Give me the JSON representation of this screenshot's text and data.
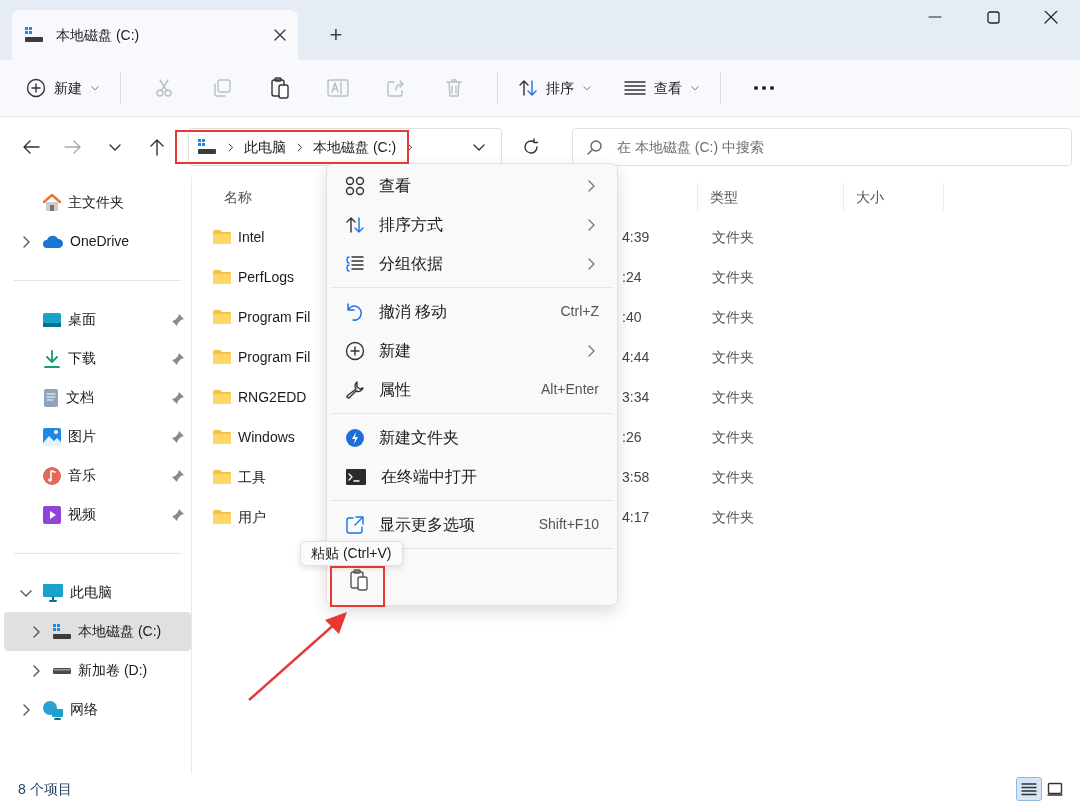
{
  "window": {
    "tab_title": "本地磁盘 (C:)",
    "new_tab": "+"
  },
  "toolbar": {
    "new_label": "新建",
    "tools": [
      {
        "kind": "cut",
        "disabled": true
      },
      {
        "kind": "copy",
        "disabled": true
      },
      {
        "kind": "paste",
        "disabled": false
      },
      {
        "kind": "rename",
        "disabled": true
      },
      {
        "kind": "share",
        "disabled": true
      },
      {
        "kind": "delete",
        "disabled": true
      }
    ],
    "sort_label": "排序",
    "view_label": "查看"
  },
  "address": {
    "path": [
      "此电脑",
      "本地磁盘 (C:)"
    ]
  },
  "search": {
    "placeholder": "在 本地磁盘 (C:) 中搜索"
  },
  "sidebar": {
    "sections": [
      [
        {
          "kind": "home",
          "label": "主文件夹"
        },
        {
          "kind": "cloud",
          "label": "OneDrive",
          "expanded": false
        }
      ],
      [
        {
          "kind": "desktop",
          "label": "桌面",
          "pinned": true
        },
        {
          "kind": "download",
          "label": "下载",
          "pinned": true
        },
        {
          "kind": "document",
          "label": "文档",
          "pinned": true
        },
        {
          "kind": "picture",
          "label": "图片",
          "pinned": true
        },
        {
          "kind": "music",
          "label": "音乐",
          "pinned": true
        },
        {
          "kind": "video",
          "label": "视频",
          "pinned": true
        }
      ],
      [
        {
          "kind": "pc",
          "label": "此电脑",
          "expanded": true,
          "children": [
            {
              "kind": "drive-c",
              "label": "本地磁盘 (C:)",
              "expanded": false,
              "selected": true
            },
            {
              "kind": "drive",
              "label": "新加卷 (D:)",
              "expanded": false,
              "selected": false
            }
          ]
        },
        {
          "kind": "network",
          "label": "网络",
          "expanded": false
        }
      ]
    ]
  },
  "table": {
    "columns": [
      "名称",
      "类型",
      "大小"
    ],
    "rows": [
      {
        "name": "Intel",
        "time": "4:39",
        "type": "文件夹"
      },
      {
        "name": "PerfLogs",
        "time": ":24",
        "type": "文件夹"
      },
      {
        "name": "Program Fil",
        "time": ":40",
        "type": "文件夹"
      },
      {
        "name": "Program Fil",
        "time": "4:44",
        "type": "文件夹"
      },
      {
        "name": "RNG2EDD",
        "time": "3:34",
        "type": "文件夹"
      },
      {
        "name": "Windows",
        "time": ":26",
        "type": "文件夹"
      },
      {
        "name": "工具",
        "time": "3:58",
        "type": "文件夹"
      },
      {
        "name": "用户",
        "time": "4:17",
        "type": "文件夹"
      }
    ]
  },
  "context_menu": {
    "sections": [
      [
        {
          "kind": "grid",
          "label": "查看",
          "submenu": true
        },
        {
          "kind": "sort",
          "label": "排序方式",
          "submenu": true
        },
        {
          "kind": "group",
          "label": "分组依据",
          "submenu": true
        }
      ],
      [
        {
          "kind": "undo",
          "label": "撤消 移动",
          "shortcut": "Ctrl+Z"
        },
        {
          "kind": "plus",
          "label": "新建",
          "submenu": true
        },
        {
          "kind": "wrench",
          "label": "属性",
          "shortcut": "Alt+Enter"
        }
      ],
      [
        {
          "kind": "bolt",
          "label": "新建文件夹"
        },
        {
          "kind": "terminal",
          "label": "在终端中打开"
        }
      ],
      [
        {
          "kind": "external",
          "label": "显示更多选项",
          "shortcut": "Shift+F10"
        }
      ]
    ],
    "tooltip": "粘贴 (Ctrl+V)"
  },
  "status_bar": {
    "count": "8 个项目",
    "views": [
      {
        "kind": "details",
        "selected": true
      },
      {
        "kind": "tiles",
        "selected": false
      }
    ]
  }
}
